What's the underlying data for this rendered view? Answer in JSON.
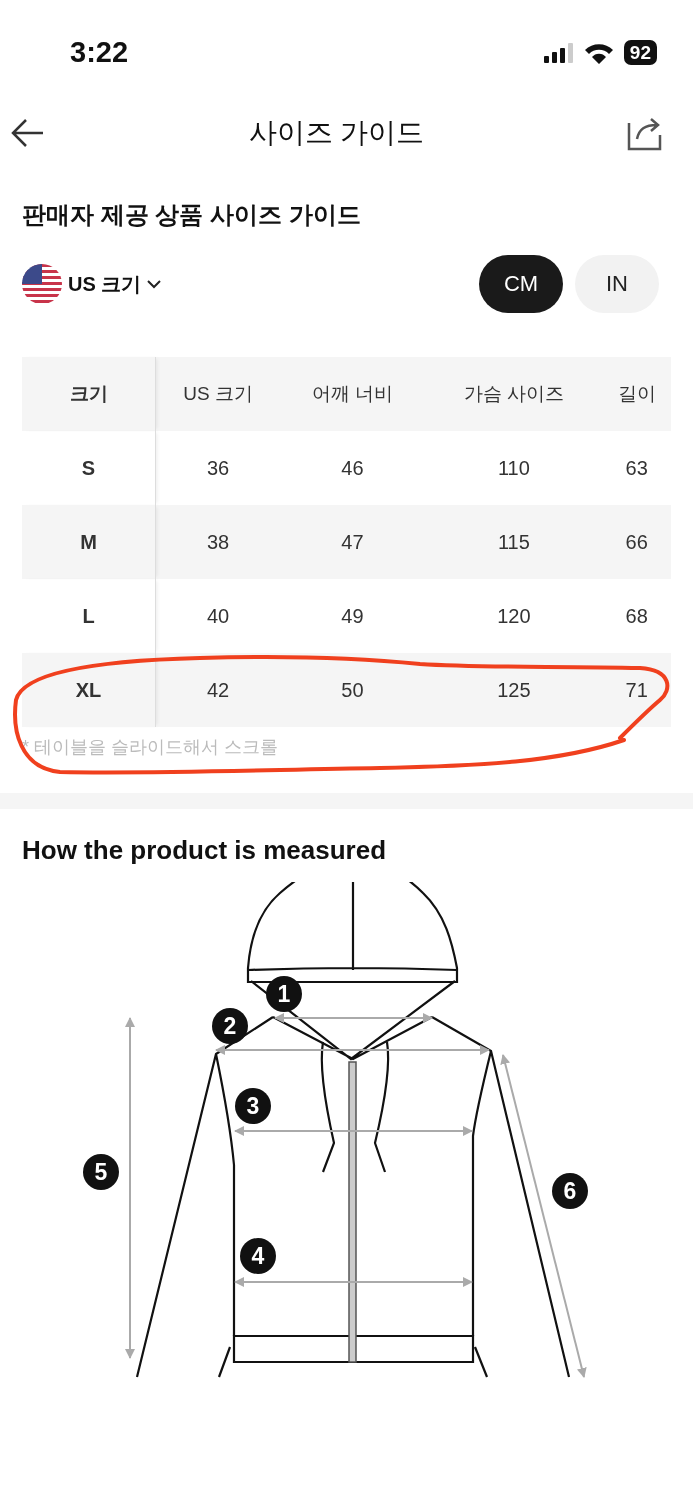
{
  "status_bar": {
    "time": "3:22",
    "battery": "92"
  },
  "header": {
    "title": "사이즈 가이드"
  },
  "section_title": "판매자 제공 상품 사이즈 가이드",
  "size_system": {
    "label": "US 크기"
  },
  "units": [
    {
      "label": "CM",
      "selected": true
    },
    {
      "label": "IN",
      "selected": false
    }
  ],
  "table": {
    "columns": [
      "크기",
      "US 크기",
      "어깨 너비",
      "가슴 사이즈",
      "길이"
    ],
    "rows": [
      [
        "S",
        "36",
        "46",
        "110",
        "63"
      ],
      [
        "M",
        "38",
        "47",
        "115",
        "66"
      ],
      [
        "L",
        "40",
        "49",
        "120",
        "68"
      ],
      [
        "XL",
        "42",
        "50",
        "125",
        "71"
      ]
    ]
  },
  "footnote": "* 테이블을 슬라이드해서 스크롤",
  "measure": {
    "title": "How the product is measured",
    "markers": [
      "1",
      "2",
      "3",
      "4",
      "5",
      "6"
    ]
  }
}
